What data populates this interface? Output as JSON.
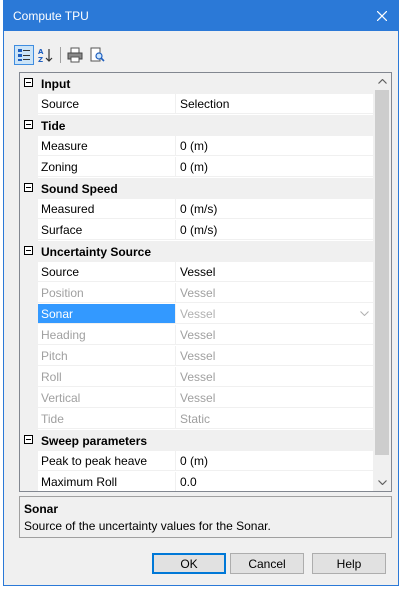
{
  "window": {
    "title": "Compute TPU",
    "close_symbol": "✕"
  },
  "toolbar": {
    "buttons": [
      {
        "name": "categorized-icon",
        "active": true
      },
      {
        "name": "alphabetical-sort-icon",
        "active": false
      },
      {
        "name": "print-icon",
        "active": false
      },
      {
        "name": "print-preview-icon",
        "active": false
      }
    ]
  },
  "categories": {
    "input": {
      "label": "Input",
      "items": [
        {
          "name": "Source",
          "value": "Selection"
        }
      ]
    },
    "tide": {
      "label": "Tide",
      "items": [
        {
          "name": "Measure",
          "value": "0 (m)"
        },
        {
          "name": "Zoning",
          "value": "0 (m)"
        }
      ]
    },
    "sound_speed": {
      "label": "Sound Speed",
      "items": [
        {
          "name": "Measured",
          "value": "0 (m/s)"
        },
        {
          "name": "Surface",
          "value": "0 (m/s)"
        }
      ]
    },
    "uncertainty_source": {
      "label": "Uncertainty Source",
      "items": [
        {
          "name": "Source",
          "value": "Vessel"
        },
        {
          "name": "Position",
          "value": "Vessel"
        },
        {
          "name": "Sonar",
          "value": "Vessel"
        },
        {
          "name": "Heading",
          "value": "Vessel"
        },
        {
          "name": "Pitch",
          "value": "Vessel"
        },
        {
          "name": "Roll",
          "value": "Vessel"
        },
        {
          "name": "Vertical",
          "value": "Vessel"
        },
        {
          "name": "Tide",
          "value": "Static"
        }
      ]
    },
    "sweep_parameters": {
      "label": "Sweep parameters",
      "items": [
        {
          "name": "Peak to peak heave",
          "value": "0 (m)"
        },
        {
          "name": "Maximum Roll",
          "value": "0.0"
        }
      ]
    }
  },
  "help": {
    "title": "Sonar",
    "description": "Source of the uncertainty values for the Sonar."
  },
  "buttons": {
    "ok": "OK",
    "cancel": "Cancel",
    "help": "Help"
  },
  "colors": {
    "title_bar": "#2b79d7",
    "selection": "#3399ff",
    "disabled_text": "#a0a0a0"
  }
}
